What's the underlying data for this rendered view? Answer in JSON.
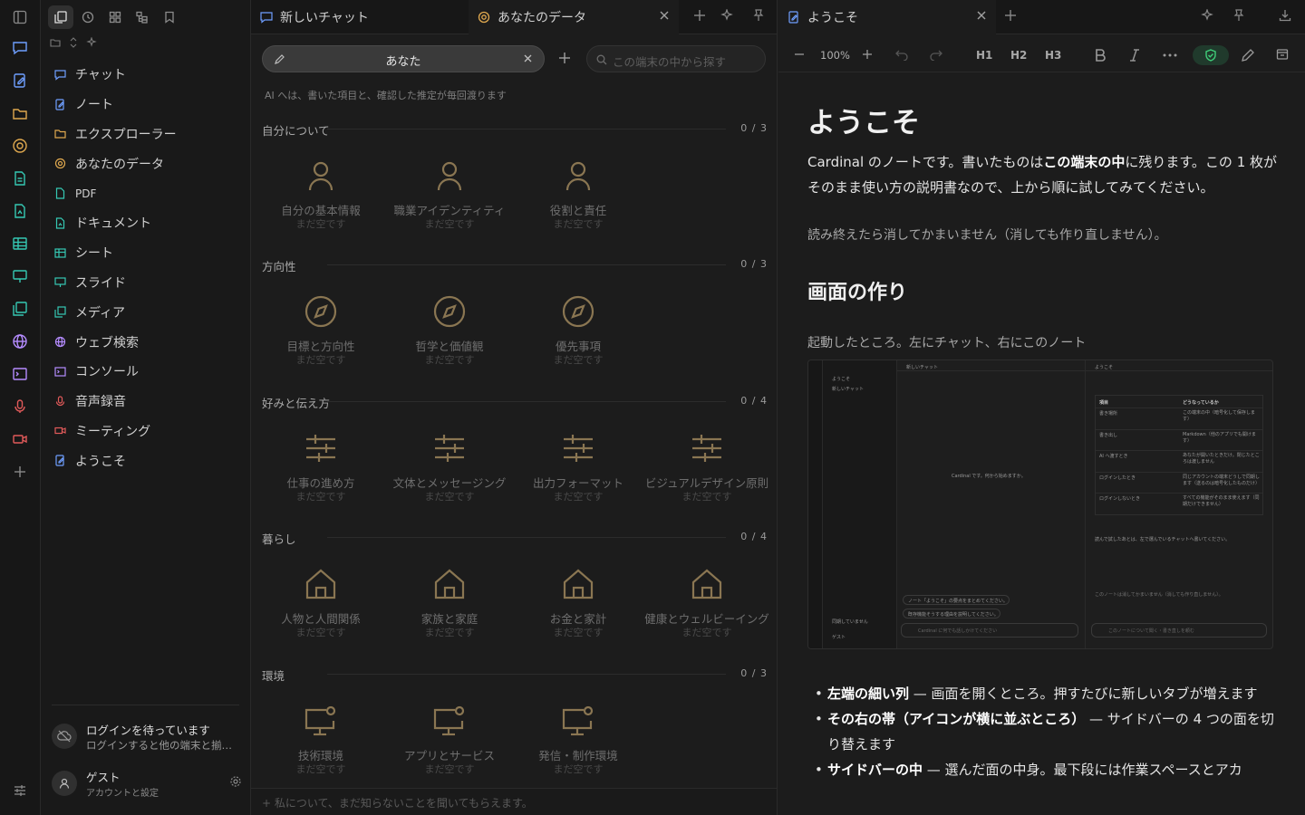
{
  "sidebar": {
    "items": [
      {
        "label": "チャット",
        "icon": "chat-icon"
      },
      {
        "label": "ノート",
        "icon": "note-icon"
      },
      {
        "label": "エクスプローラー",
        "icon": "folder-icon"
      },
      {
        "label": "あなたのデータ",
        "icon": "data-icon"
      },
      {
        "label": "PDF",
        "icon": "pdf-icon"
      },
      {
        "label": "ドキュメント",
        "icon": "document-icon"
      },
      {
        "label": "シート",
        "icon": "sheet-icon"
      },
      {
        "label": "スライド",
        "icon": "slide-icon"
      },
      {
        "label": "メディア",
        "icon": "media-icon"
      },
      {
        "label": "ウェブ検索",
        "icon": "globe-icon"
      },
      {
        "label": "コンソール",
        "icon": "console-icon"
      },
      {
        "label": "音声録音",
        "icon": "mic-icon"
      },
      {
        "label": "ミーティング",
        "icon": "video-icon"
      },
      {
        "label": "ようこそ",
        "icon": "note-icon"
      }
    ],
    "login": {
      "title": "ログインを待っています",
      "subtitle": "ログインすると他の端末と揃い..."
    },
    "guest": {
      "name": "ゲスト",
      "sub": "アカウントと設定"
    }
  },
  "middle": {
    "tabs": [
      {
        "label": "新しいチャット"
      },
      {
        "label": "あなたのデータ"
      }
    ],
    "you_label": "あなた",
    "search_placeholder": "この端末の中から探す",
    "note": "AI へは、書いた項目と、確認した推定が毎回渡ります",
    "sections": [
      {
        "title": "自分について",
        "count": "0 / 3",
        "icon": "person-icon",
        "cards": [
          {
            "title": "自分の基本情報",
            "status": "まだ空です"
          },
          {
            "title": "職業アイデンティティ",
            "status": "まだ空です"
          },
          {
            "title": "役割と責任",
            "status": "まだ空です"
          }
        ]
      },
      {
        "title": "方向性",
        "count": "0 / 3",
        "icon": "compass-icon",
        "cards": [
          {
            "title": "目標と方向性",
            "status": "まだ空です"
          },
          {
            "title": "哲学と価値観",
            "status": "まだ空です"
          },
          {
            "title": "優先事項",
            "status": "まだ空です"
          }
        ]
      },
      {
        "title": "好みと伝え方",
        "count": "0 / 4",
        "icon": "sliders-icon",
        "cards": [
          {
            "title": "仕事の進め方",
            "status": "まだ空です"
          },
          {
            "title": "文体とメッセージング",
            "status": "まだ空です"
          },
          {
            "title": "出力フォーマット",
            "status": "まだ空です"
          },
          {
            "title": "ビジュアルデザイン原則",
            "status": "まだ空です"
          }
        ]
      },
      {
        "title": "暮らし",
        "count": "0 / 4",
        "icon": "house-icon",
        "cards": [
          {
            "title": "人物と人間関係",
            "status": "まだ空です"
          },
          {
            "title": "家族と家庭",
            "status": "まだ空です"
          },
          {
            "title": "お金と家計",
            "status": "まだ空です"
          },
          {
            "title": "健康とウェルビーイング",
            "status": "まだ空です"
          }
        ]
      },
      {
        "title": "環境",
        "count": "0 / 3",
        "icon": "monitor-gear-icon",
        "cards": [
          {
            "title": "技術環境",
            "status": "まだ空です"
          },
          {
            "title": "アプリとサービス",
            "status": "まだ空です"
          },
          {
            "title": "発信・制作環境",
            "status": "まだ空です"
          }
        ]
      }
    ],
    "ask_placeholder": "+ 私について、まだ知らないことを聞いてもらえます。"
  },
  "right": {
    "tab": "ようこそ",
    "zoom": "100%",
    "headings": [
      "H1",
      "H2",
      "H3"
    ],
    "doc": {
      "title": "ようこそ",
      "lead_1": "Cardinal のノートです。書いたものは",
      "lead_bold": "この端末の中",
      "lead_2": "に残ります。この 1 枚がそのまま使い方の説明書なので、上から順に試してみてください。",
      "muted": "読み終えたら消してかまいません（消しても作り直しません）。",
      "h2": "画面の作り",
      "caption": "起動したところ。左にチャット、右にこのノート",
      "bullets": [
        {
          "bold": "左端の細い列",
          "text": " — 画面を開くところ。押すたびに新しいタブが増えます"
        },
        {
          "bold": "その右の帯（アイコンが横に並ぶところ）",
          "text": " — サイドバーの 4 つの面を切り替えます"
        },
        {
          "bold": "サイドバーの中",
          "text": " — 選んだ面の中身。最下段には作業スペースとアカ"
        }
      ]
    },
    "shot": {
      "tab_chat": "新しいチャット",
      "tab_welcome": "ようこそ",
      "side_welcome": "ようこそ",
      "side_chat": "新しいチャット",
      "center": "Cardinal です。何から始めますか。",
      "table_h1": "項目",
      "table_h2": "どうなっているか",
      "rows": [
        [
          "書き場所",
          "この端末の中（暗号化して保存します）"
        ],
        [
          "書き出し",
          "Markdown（他のアプリでも開けます）"
        ],
        [
          "AI へ渡すとき",
          "あなたが開いたときだけ。閉じたところは渡しません"
        ],
        [
          "ログインしたとき",
          "同じアカウントの端末どうしで同期します（送るのは暗号化したものだけ）"
        ],
        [
          "ログインしないとき",
          "すべての機能がそのまま使えます（同期だけできません）"
        ]
      ],
      "foot_note": "読んで試したあとは、左で選んでいるチャットへ書いてください。",
      "status_note": "このノートは消してかまいません（消しても作り直しません）。",
      "chip1": "ノート「ようこそ」の要点をまとめてください。",
      "chip2": "既存機能そうする理由を説明してください。",
      "input1": "Cardinal に何でも話しかけてください",
      "input2": "このノートについて聞く・書き直しを頼む",
      "login1": "同期していません",
      "guest": "ゲスト"
    }
  }
}
